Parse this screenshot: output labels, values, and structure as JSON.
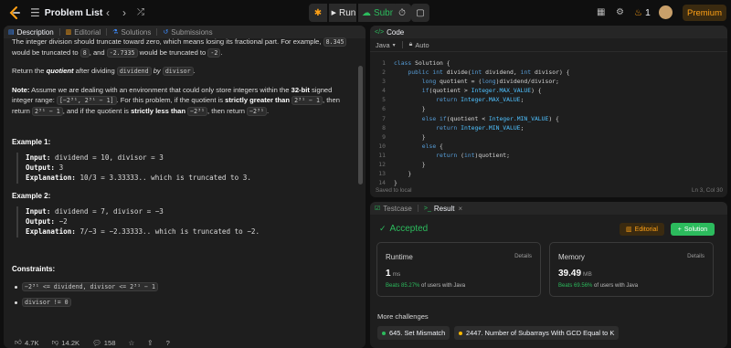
{
  "nav": {
    "title": "Problem List",
    "run_label": "Run",
    "submit_label": "Submit",
    "streak": "1",
    "premium_label": "Premium"
  },
  "left": {
    "tabs": [
      {
        "label": "Description"
      },
      {
        "label": "Editorial"
      },
      {
        "label": "Solutions"
      },
      {
        "label": "Submissions"
      }
    ],
    "stats": {
      "likes": "4.7K",
      "dislikes": "14.2K",
      "comments": "158"
    }
  },
  "description": {
    "p1_pre": "The integer division should truncate toward zero, which means losing its fractional part. For example, ",
    "p1_c1": "8.345",
    "p1_mid1": " would be truncated to ",
    "p1_c2": "8",
    "p1_mid2": ", and ",
    "p1_c3": "-2.7335",
    "p1_mid3": " would be truncated to ",
    "p1_c4": "-2",
    "p1_end": ".",
    "p2_pre": "Return the ",
    "p2_em": "quotient",
    "p2_mid": " after dividing ",
    "p2_c1": "dividend",
    "p2_by": " by ",
    "p2_c2": "divisor",
    "p2_end": ".",
    "note_label": "Note:",
    "note_1": " Assume we are dealing with an environment that could only store integers within the ",
    "note_b1": "32-bit",
    "note_2": " signed integer range: ",
    "note_c1": "[−2³¹, 2³¹ − 1]",
    "note_3": ". For this problem, if the quotient is ",
    "note_b2": "strictly greater than",
    "note_4": " ",
    "note_c2": "2³¹ − 1",
    "note_5": ", then return ",
    "note_c3": "2³¹ − 1",
    "note_6": ", and if the quotient is ",
    "note_b3": "strictly less than",
    "note_7": " ",
    "note_c4": "−2³¹",
    "note_8": ", then return ",
    "note_c5": "−2³¹",
    "note_9": ".",
    "ex1_title": "Example 1:",
    "ex1_input_label": "Input:",
    "ex1_input": " dividend = 10, divisor = 3",
    "ex1_output_label": "Output:",
    "ex1_output": " 3",
    "ex1_expl_label": "Explanation:",
    "ex1_expl": " 10/3 = 3.33333.. which is truncated to 3.",
    "ex2_title": "Example 2:",
    "ex2_input_label": "Input:",
    "ex2_input": " dividend = 7, divisor = −3",
    "ex2_output_label": "Output:",
    "ex2_output": " −2",
    "ex2_expl_label": "Explanation:",
    "ex2_expl": " 7/−3 = −2.33333.. which is truncated to −2.",
    "constraints_title": "Constraints:",
    "constraint1": "−2³¹ <= dividend, divisor <= 2³¹ − 1",
    "constraint2": "divisor != 0"
  },
  "code": {
    "tab_label": "Code",
    "language": "Java",
    "auto_label": "Auto",
    "saved": "Saved to local",
    "cursor": "Ln 3, Col 30",
    "lines": [
      "class Solution {",
      "    public int divide(int dividend, int divisor) {",
      "        long quotient = (long)dividend/divisor;",
      "        if(quotient > Integer.MAX_VALUE) {",
      "            return Integer.MAX_VALUE;",
      "        }",
      "        else if(quotient < Integer.MIN_VALUE) {",
      "            return Integer.MIN_VALUE;",
      "        }",
      "        else {",
      "            return (int)quotient;",
      "        }",
      "    }",
      "}"
    ]
  },
  "result": {
    "tabs": [
      {
        "label": "Testcase"
      },
      {
        "label": "Result"
      }
    ],
    "status": "Accepted",
    "editorial_label": "Editorial",
    "solution_label": "Solution",
    "runtime": {
      "title": "Runtime",
      "details": "Details",
      "value": "1",
      "unit": "ms",
      "beats_pct": "Beats 85.27%",
      "beats_rest": " of users with Java"
    },
    "memory": {
      "title": "Memory",
      "details": "Details",
      "value": "39.49",
      "unit": "MB",
      "beats_pct": "Beats 69.56%",
      "beats_rest": " of users with Java"
    },
    "more_title": "More challenges",
    "challenges": [
      {
        "label": "645. Set Mismatch",
        "color": "#2cbb5d"
      },
      {
        "label": "2447. Number of Subarrays With GCD Equal to K",
        "color": "#ffb800"
      }
    ]
  },
  "colors": {
    "accent_green": "#2cbb5d",
    "accent_orange": "#ffa116",
    "panel": "#1e1e1e",
    "background": "#0f0f0f"
  }
}
